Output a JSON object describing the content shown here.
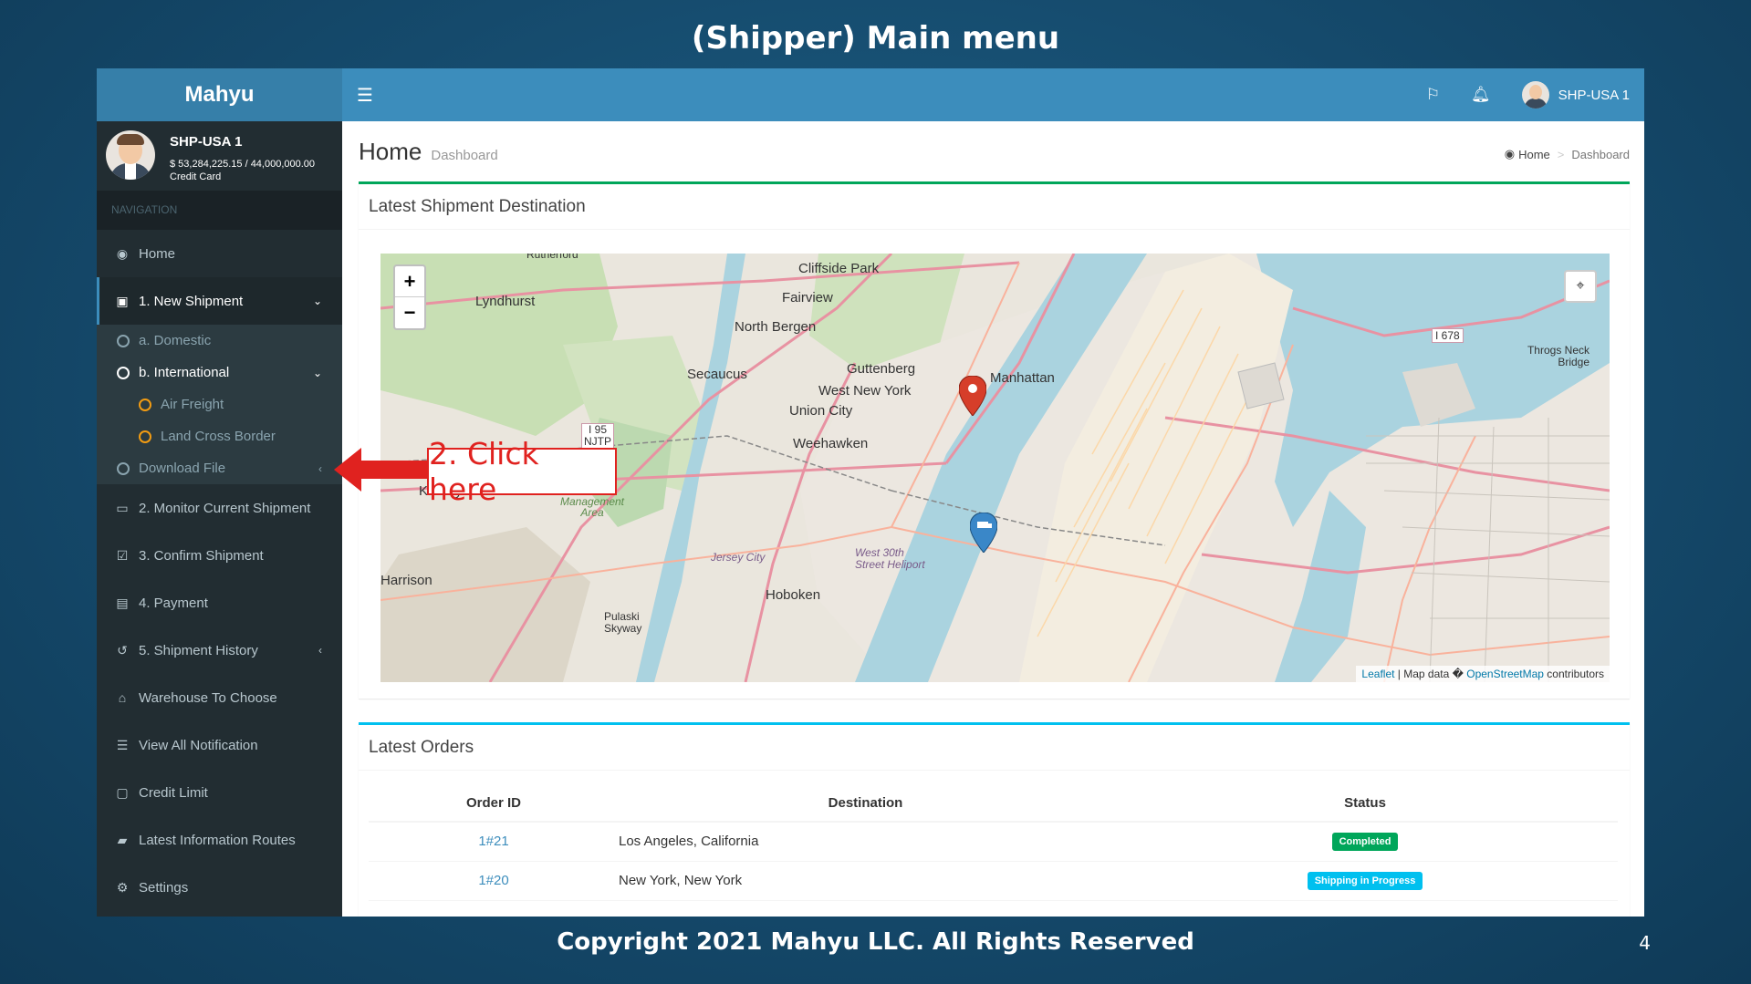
{
  "slide": {
    "title": "(Shipper) Main menu",
    "footer": "Copyright 2021 Mahyu LLC. All Rights Reserved",
    "page_number": "4"
  },
  "app": {
    "logo": "Mahyu",
    "user": {
      "name": "SHP-USA 1",
      "balance": "$ 53,284,225.15 / 44,000,000.00",
      "type": "Credit Card"
    },
    "nav_header": "NAVIGATION",
    "nav": {
      "home": "Home",
      "new_shipment": "1. New Shipment",
      "domestic": "a. Domestic",
      "international": "b. International",
      "air_freight": "Air Freight",
      "land_cross_border": "Land Cross Border",
      "download_file": "Download File",
      "monitor": "2. Monitor Current Shipment",
      "confirm": "3. Confirm Shipment",
      "payment": "4. Payment",
      "history": "5. Shipment History",
      "warehouse": "Warehouse To Choose",
      "notifications": "View All Notification",
      "credit_limit": "Credit Limit",
      "routes": "Latest Information Routes",
      "settings": "Settings"
    },
    "topbar": {
      "user": "SHP-USA 1"
    }
  },
  "content": {
    "title": "Home",
    "subtitle": "Dashboard",
    "breadcrumb": {
      "home": "Home",
      "current": "Dashboard"
    },
    "map_box": {
      "title": "Latest Shipment Destination",
      "zoom_in": "+",
      "zoom_out": "−",
      "attribution_leaflet": "Leaflet",
      "attribution_mid": " | Map data � ",
      "attribution_osm": "OpenStreetMap",
      "attribution_end": " contributors",
      "labels": {
        "cliffside": "Cliffside Park",
        "fairview": "Fairview",
        "north_bergen": "North Bergen",
        "lyndhurst": "Lyndhurst",
        "secaucus": "Secaucus",
        "guttenberg": "Guttenberg",
        "west_new_york": "West New York",
        "union_city": "Union City",
        "weehawken": "Weehawken",
        "manhattan": "Manhattan",
        "kearny": "Kearny",
        "harrison": "Harrison",
        "hoboken": "Hoboken",
        "pulaski": "Pulaski Skyway",
        "throgs": "Throgs Neck Bridge",
        "i95": "I 95 NJTP",
        "i678": "I 678",
        "rutherford": "Rutherford",
        "heliport": "West 30th Street Heliport",
        "jersey_city": "Jersey City",
        "sawmill": "Saw Mill Creek Wildlife Management Area"
      }
    },
    "orders_box": {
      "title": "Latest Orders",
      "columns": [
        "Order ID",
        "Destination",
        "Status"
      ],
      "rows": [
        {
          "id": "1#21",
          "destination": "Los Angeles, California",
          "status": "Completed",
          "status_color": "#00a65a"
        },
        {
          "id": "1#20",
          "destination": "New York, New York",
          "status": "Shipping in Progress",
          "status_color": "#00c0ef"
        }
      ]
    }
  },
  "annotation": {
    "text": "2. Click here",
    "color": "#e0221f"
  },
  "colors": {
    "header_blue": "#3c8dbc",
    "logo_blue": "#367fa9",
    "sidebar": "#222d32",
    "success": "#00a65a",
    "info": "#00c0ef"
  }
}
